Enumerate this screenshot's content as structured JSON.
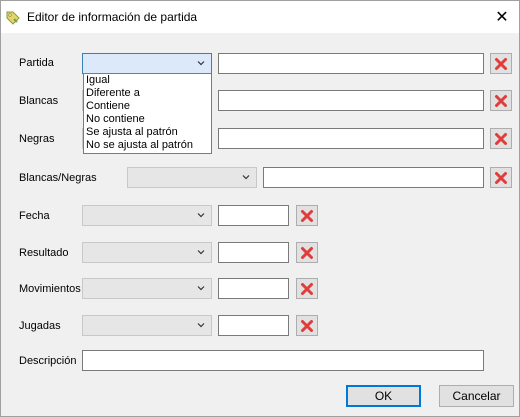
{
  "window": {
    "title": "Editor de información de partida",
    "icon": "tag-icon",
    "close_label": "✕"
  },
  "fields": {
    "partida": "Partida",
    "blancas": "Blancas",
    "negras": "Negras",
    "blancas_negras": "Blancas/Negras",
    "fecha": "Fecha",
    "resultado": "Resultado",
    "movimientos": "Movimientos",
    "jugadas": "Jugadas",
    "descripcion": "Descripción"
  },
  "dropdown": {
    "options": [
      "Igual",
      "Diferente a",
      "Contiene",
      "No contiene",
      "Se ajusta al patrón",
      "No se ajusta al patrón"
    ]
  },
  "buttons": {
    "ok": "OK",
    "cancel": "Cancelar"
  },
  "colors": {
    "clear_icon": "#e03c3c",
    "accent": "#0078d7"
  }
}
